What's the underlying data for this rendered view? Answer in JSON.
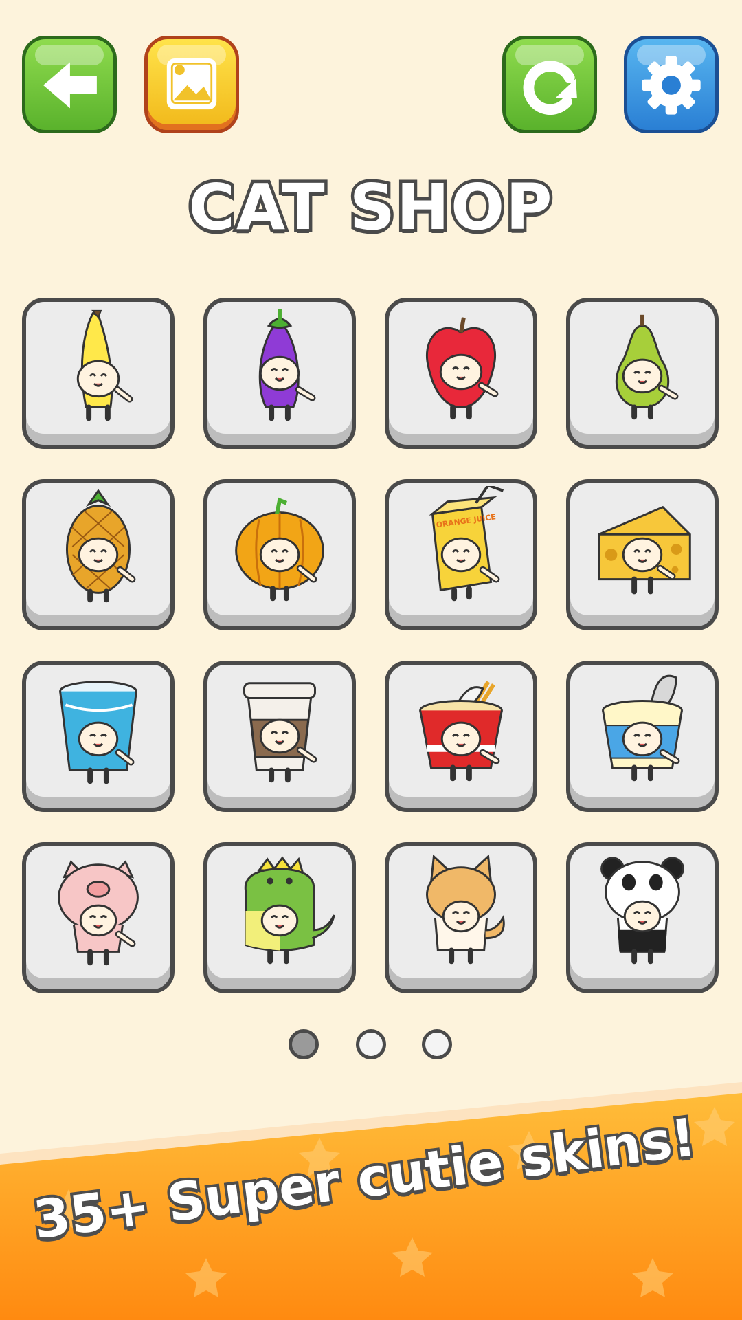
{
  "header": {
    "back_icon": "arrow-left-icon",
    "image_icon": "image-gallery-icon",
    "reset_icon": "refresh-icon",
    "settings_icon": "gear-icon"
  },
  "title": "CAT SHOP",
  "skins": [
    {
      "name": "banana",
      "color": "#ffe84a"
    },
    {
      "name": "eggplant",
      "color": "#8f3bd6"
    },
    {
      "name": "apple",
      "color": "#e8283a"
    },
    {
      "name": "pear",
      "color": "#a7cf3a"
    },
    {
      "name": "pineapple",
      "color": "#e8a52a"
    },
    {
      "name": "pumpkin",
      "color": "#f2a516"
    },
    {
      "name": "orange-juice",
      "color": "#f7d33a",
      "text": "ORANGE JUICE"
    },
    {
      "name": "cheese",
      "color": "#f7c73a"
    },
    {
      "name": "soda-cup",
      "color": "#3fb3e0"
    },
    {
      "name": "coffee-cup",
      "color": "#8a6a4e"
    },
    {
      "name": "noodle-cup",
      "color": "#e02a2a"
    },
    {
      "name": "yogurt",
      "color": "#4aa6e6"
    },
    {
      "name": "pig",
      "color": "#f7c6c6"
    },
    {
      "name": "dragon",
      "color": "#7ac143"
    },
    {
      "name": "shiba",
      "color": "#f0b868"
    },
    {
      "name": "panda",
      "color": "#ffffff"
    }
  ],
  "pagination": {
    "pages": 3,
    "current": 1
  },
  "banner": {
    "text": "35+ Super cutie skins!",
    "color_top": "#ffbd3a",
    "color_bottom": "#ff8a10"
  },
  "colors": {
    "background": "#fdf3dc",
    "outline": "#4a4a4a",
    "tile": "#ececec"
  }
}
